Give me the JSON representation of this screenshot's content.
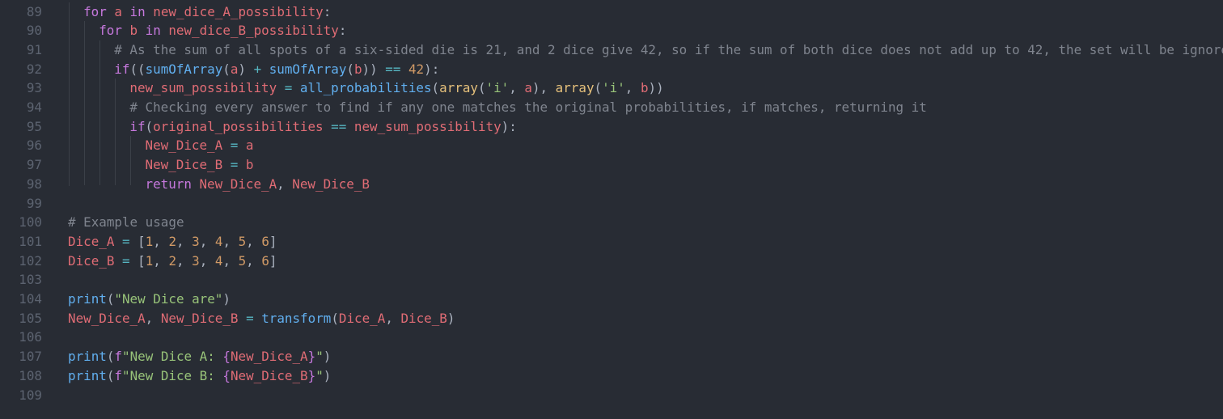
{
  "editor": {
    "colors": {
      "background": "#282c34",
      "line_number": "#5c6370",
      "keyword": "#c678dd",
      "variable": "#e06c75",
      "function": "#61afef",
      "number": "#d19a66",
      "string": "#98c379",
      "operator": "#56b6c2",
      "comment": "#7f848e",
      "builtin_class": "#e5c07b",
      "punctuation": "#abb2bf"
    },
    "lines": [
      {
        "num": "89",
        "indent": 1,
        "tokens": [
          {
            "t": "kw",
            "v": "for"
          },
          {
            "t": "plain",
            "v": " "
          },
          {
            "t": "var",
            "v": "a"
          },
          {
            "t": "plain",
            "v": " "
          },
          {
            "t": "kw",
            "v": "in"
          },
          {
            "t": "plain",
            "v": " "
          },
          {
            "t": "var",
            "v": "new_dice_A_possibility"
          },
          {
            "t": "pun",
            "v": ":"
          }
        ]
      },
      {
        "num": "90",
        "indent": 2,
        "tokens": [
          {
            "t": "kw",
            "v": "for"
          },
          {
            "t": "plain",
            "v": " "
          },
          {
            "t": "var",
            "v": "b"
          },
          {
            "t": "plain",
            "v": " "
          },
          {
            "t": "kw",
            "v": "in"
          },
          {
            "t": "plain",
            "v": " "
          },
          {
            "t": "var",
            "v": "new_dice_B_possibility"
          },
          {
            "t": "pun",
            "v": ":"
          }
        ]
      },
      {
        "num": "91",
        "indent": 3,
        "tokens": [
          {
            "t": "com",
            "v": "# As the sum of all spots of a six-sided die is 21, and 2 dice give 42, so if the sum of both dice does not add up to 42, the set will be ignored"
          }
        ]
      },
      {
        "num": "92",
        "indent": 3,
        "tokens": [
          {
            "t": "kw",
            "v": "if"
          },
          {
            "t": "pun",
            "v": "(("
          },
          {
            "t": "fn",
            "v": "sumOfArray"
          },
          {
            "t": "pun",
            "v": "("
          },
          {
            "t": "var",
            "v": "a"
          },
          {
            "t": "pun",
            "v": ")"
          },
          {
            "t": "plain",
            "v": " "
          },
          {
            "t": "op",
            "v": "+"
          },
          {
            "t": "plain",
            "v": " "
          },
          {
            "t": "fn",
            "v": "sumOfArray"
          },
          {
            "t": "pun",
            "v": "("
          },
          {
            "t": "var",
            "v": "b"
          },
          {
            "t": "pun",
            "v": "))"
          },
          {
            "t": "plain",
            "v": " "
          },
          {
            "t": "op",
            "v": "=="
          },
          {
            "t": "plain",
            "v": " "
          },
          {
            "t": "num",
            "v": "42"
          },
          {
            "t": "pun",
            "v": "):"
          }
        ]
      },
      {
        "num": "93",
        "indent": 4,
        "tokens": [
          {
            "t": "var",
            "v": "new_sum_possibility"
          },
          {
            "t": "plain",
            "v": " "
          },
          {
            "t": "op",
            "v": "="
          },
          {
            "t": "plain",
            "v": " "
          },
          {
            "t": "fn",
            "v": "all_probabilities"
          },
          {
            "t": "pun",
            "v": "("
          },
          {
            "t": "cls",
            "v": "array"
          },
          {
            "t": "pun",
            "v": "("
          },
          {
            "t": "str",
            "v": "'i'"
          },
          {
            "t": "pun",
            "v": ", "
          },
          {
            "t": "var",
            "v": "a"
          },
          {
            "t": "pun",
            "v": "), "
          },
          {
            "t": "cls",
            "v": "array"
          },
          {
            "t": "pun",
            "v": "("
          },
          {
            "t": "str",
            "v": "'i'"
          },
          {
            "t": "pun",
            "v": ", "
          },
          {
            "t": "var",
            "v": "b"
          },
          {
            "t": "pun",
            "v": "))"
          }
        ]
      },
      {
        "num": "94",
        "indent": 4,
        "tokens": [
          {
            "t": "com",
            "v": "# Checking every answer to find if any one matches the original probabilities, if matches, returning it"
          }
        ]
      },
      {
        "num": "95",
        "indent": 4,
        "tokens": [
          {
            "t": "kw",
            "v": "if"
          },
          {
            "t": "pun",
            "v": "("
          },
          {
            "t": "var",
            "v": "original_possibilities"
          },
          {
            "t": "plain",
            "v": " "
          },
          {
            "t": "op",
            "v": "=="
          },
          {
            "t": "plain",
            "v": " "
          },
          {
            "t": "var",
            "v": "new_sum_possibility"
          },
          {
            "t": "pun",
            "v": "):"
          }
        ]
      },
      {
        "num": "96",
        "indent": 5,
        "tokens": [
          {
            "t": "var",
            "v": "New_Dice_A"
          },
          {
            "t": "plain",
            "v": " "
          },
          {
            "t": "op",
            "v": "="
          },
          {
            "t": "plain",
            "v": " "
          },
          {
            "t": "var",
            "v": "a"
          }
        ]
      },
      {
        "num": "97",
        "indent": 5,
        "tokens": [
          {
            "t": "var",
            "v": "New_Dice_B"
          },
          {
            "t": "plain",
            "v": " "
          },
          {
            "t": "op",
            "v": "="
          },
          {
            "t": "plain",
            "v": " "
          },
          {
            "t": "var",
            "v": "b"
          }
        ]
      },
      {
        "num": "98",
        "indent": 5,
        "tokens": [
          {
            "t": "kw",
            "v": "return"
          },
          {
            "t": "plain",
            "v": " "
          },
          {
            "t": "var",
            "v": "New_Dice_A"
          },
          {
            "t": "pun",
            "v": ", "
          },
          {
            "t": "var",
            "v": "New_Dice_B"
          }
        ]
      },
      {
        "num": "99",
        "indent": 0,
        "tokens": []
      },
      {
        "num": "100",
        "indent": 0,
        "tokens": [
          {
            "t": "com",
            "v": "# Example usage"
          }
        ]
      },
      {
        "num": "101",
        "indent": 0,
        "tokens": [
          {
            "t": "var",
            "v": "Dice_A"
          },
          {
            "t": "plain",
            "v": " "
          },
          {
            "t": "op",
            "v": "="
          },
          {
            "t": "plain",
            "v": " "
          },
          {
            "t": "pun",
            "v": "["
          },
          {
            "t": "num",
            "v": "1"
          },
          {
            "t": "pun",
            "v": ", "
          },
          {
            "t": "num",
            "v": "2"
          },
          {
            "t": "pun",
            "v": ", "
          },
          {
            "t": "num",
            "v": "3"
          },
          {
            "t": "pun",
            "v": ", "
          },
          {
            "t": "num",
            "v": "4"
          },
          {
            "t": "pun",
            "v": ", "
          },
          {
            "t": "num",
            "v": "5"
          },
          {
            "t": "pun",
            "v": ", "
          },
          {
            "t": "num",
            "v": "6"
          },
          {
            "t": "pun",
            "v": "]"
          }
        ]
      },
      {
        "num": "102",
        "indent": 0,
        "tokens": [
          {
            "t": "var",
            "v": "Dice_B"
          },
          {
            "t": "plain",
            "v": " "
          },
          {
            "t": "op",
            "v": "="
          },
          {
            "t": "plain",
            "v": " "
          },
          {
            "t": "pun",
            "v": "["
          },
          {
            "t": "num",
            "v": "1"
          },
          {
            "t": "pun",
            "v": ", "
          },
          {
            "t": "num",
            "v": "2"
          },
          {
            "t": "pun",
            "v": ", "
          },
          {
            "t": "num",
            "v": "3"
          },
          {
            "t": "pun",
            "v": ", "
          },
          {
            "t": "num",
            "v": "4"
          },
          {
            "t": "pun",
            "v": ", "
          },
          {
            "t": "num",
            "v": "5"
          },
          {
            "t": "pun",
            "v": ", "
          },
          {
            "t": "num",
            "v": "6"
          },
          {
            "t": "pun",
            "v": "]"
          }
        ]
      },
      {
        "num": "103",
        "indent": 0,
        "tokens": []
      },
      {
        "num": "104",
        "indent": 0,
        "tokens": [
          {
            "t": "fn",
            "v": "print"
          },
          {
            "t": "pun",
            "v": "("
          },
          {
            "t": "str",
            "v": "\"New Dice are\""
          },
          {
            "t": "pun",
            "v": ")"
          }
        ]
      },
      {
        "num": "105",
        "indent": 0,
        "tokens": [
          {
            "t": "var",
            "v": "New_Dice_A"
          },
          {
            "t": "pun",
            "v": ", "
          },
          {
            "t": "var",
            "v": "New_Dice_B"
          },
          {
            "t": "plain",
            "v": " "
          },
          {
            "t": "op",
            "v": "="
          },
          {
            "t": "plain",
            "v": " "
          },
          {
            "t": "fn",
            "v": "transform"
          },
          {
            "t": "pun",
            "v": "("
          },
          {
            "t": "var",
            "v": "Dice_A"
          },
          {
            "t": "pun",
            "v": ", "
          },
          {
            "t": "var",
            "v": "Dice_B"
          },
          {
            "t": "pun",
            "v": ")"
          }
        ]
      },
      {
        "num": "106",
        "indent": 0,
        "tokens": []
      },
      {
        "num": "107",
        "indent": 0,
        "tokens": [
          {
            "t": "fn",
            "v": "print"
          },
          {
            "t": "pun",
            "v": "("
          },
          {
            "t": "kw",
            "v": "f"
          },
          {
            "t": "str",
            "v": "\"New Dice A: "
          },
          {
            "t": "kw",
            "v": "{"
          },
          {
            "t": "var",
            "v": "New_Dice_A"
          },
          {
            "t": "kw",
            "v": "}"
          },
          {
            "t": "str",
            "v": "\""
          },
          {
            "t": "pun",
            "v": ")"
          }
        ]
      },
      {
        "num": "108",
        "indent": 0,
        "tokens": [
          {
            "t": "fn",
            "v": "print"
          },
          {
            "t": "pun",
            "v": "("
          },
          {
            "t": "kw",
            "v": "f"
          },
          {
            "t": "str",
            "v": "\"New Dice B: "
          },
          {
            "t": "kw",
            "v": "{"
          },
          {
            "t": "var",
            "v": "New_Dice_B"
          },
          {
            "t": "kw",
            "v": "}"
          },
          {
            "t": "str",
            "v": "\""
          },
          {
            "t": "pun",
            "v": ")"
          }
        ]
      },
      {
        "num": "109",
        "indent": 0,
        "tokens": []
      }
    ]
  }
}
